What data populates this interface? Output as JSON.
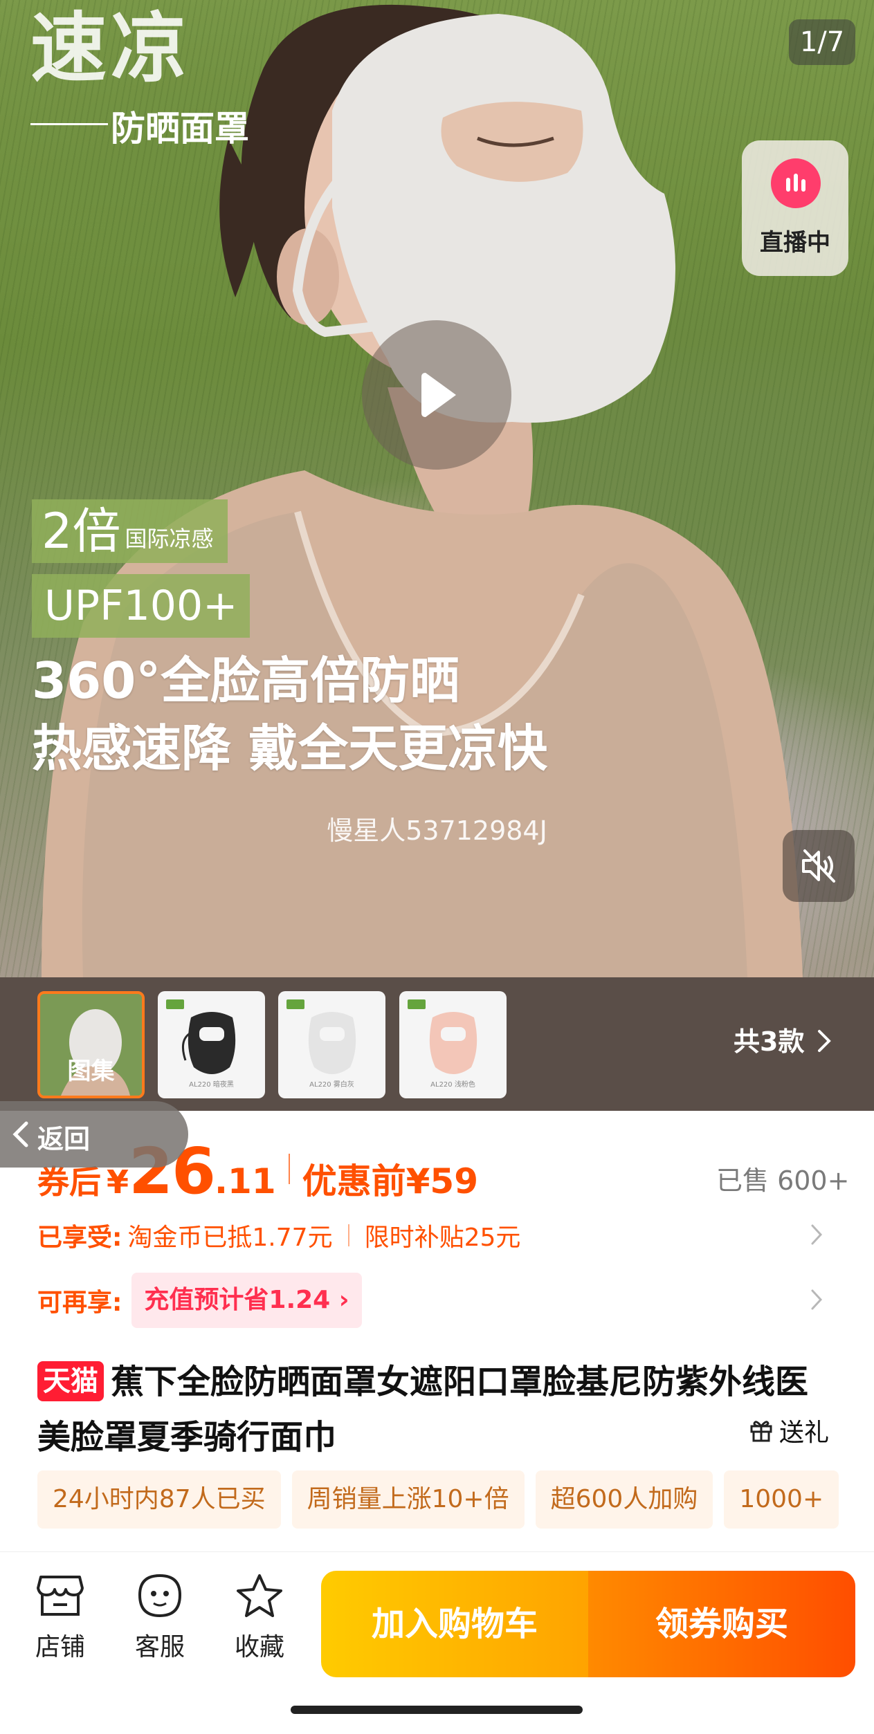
{
  "hero": {
    "brand_title": "速凉",
    "brand_subtitle": "防晒面罩",
    "counter": "1/7",
    "live_label": "直播中",
    "badge_multiplier": "2倍",
    "badge_multiplier_text": "国际凉感",
    "badge_upf": "UPF100+",
    "headline_line1": "360°全脸高倍防晒",
    "headline_line2": "热感速降 戴全天更凉快",
    "watermark": "慢星人53712984J"
  },
  "thumbnails": {
    "gallery_label": "图集",
    "items": [
      {
        "caption": "AL220 暗夜黑",
        "color": "#2a2a2a"
      },
      {
        "caption": "AL220 雾白灰",
        "color": "#e4e4e4"
      },
      {
        "caption": "AL220 浅粉色",
        "color": "#f3c6b8"
      }
    ],
    "styles_count": "共3款"
  },
  "back": {
    "label": "返回"
  },
  "price": {
    "after_label": "券后",
    "currency": "¥",
    "integer": "26",
    "decimal": ".11",
    "before_label": "优惠前¥59",
    "sold": "已售 600+"
  },
  "benefits": {
    "enjoyed_label": "已享受:",
    "coin": "淘金币已抵1.77元",
    "subsidy": "限时补贴25元",
    "more_label": "可再享:",
    "recharge": "充值预计省1.24"
  },
  "product": {
    "store_badge": "天猫",
    "title": "蕉下全脸防晒面罩女遮阳口罩脸基尼防紫外线医美脸罩夏季骑行面巾",
    "gift": "送礼"
  },
  "tags": [
    "24小时内87人已买",
    "周销量上涨10+倍",
    "超600人加购",
    "1000+"
  ],
  "bottom": {
    "store": "店铺",
    "service": "客服",
    "favorite": "收藏",
    "add_cart": "加入购物车",
    "buy": "领券购买"
  },
  "colors": {
    "accent": "#ff5000",
    "tmall": "#ff1d33",
    "live": "#ff3d6c"
  }
}
